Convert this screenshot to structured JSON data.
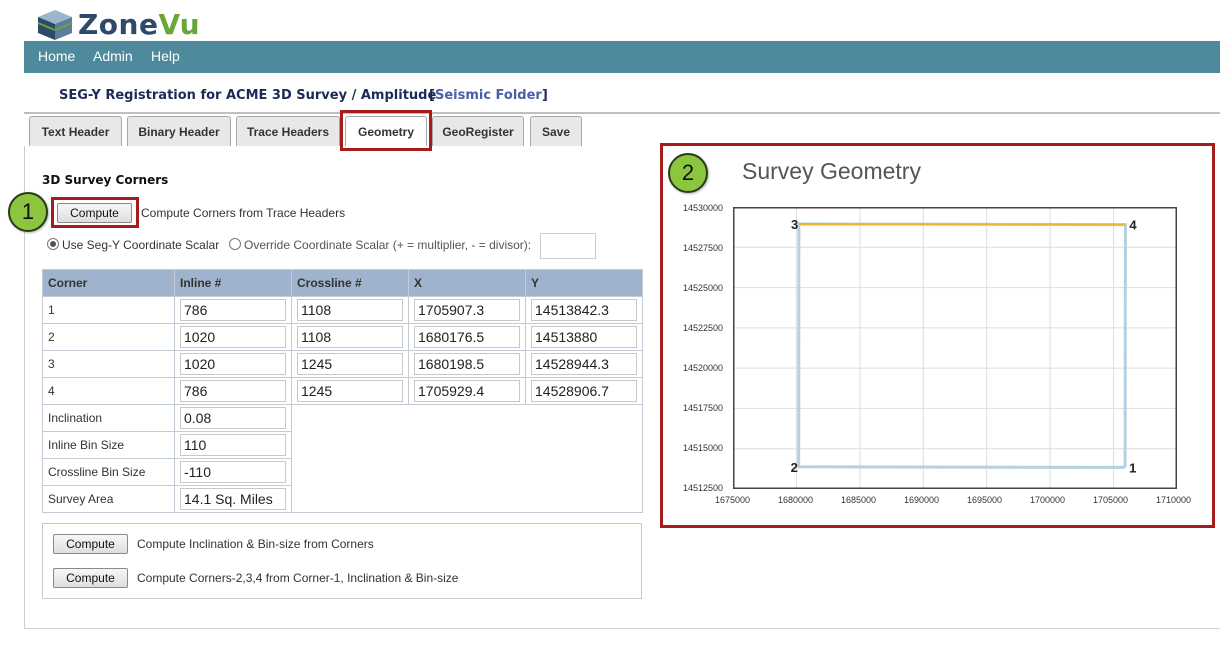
{
  "app": {
    "logo_part1": "Zone",
    "logo_part2": "Vu"
  },
  "nav": {
    "items": [
      "Home",
      "Admin",
      "Help"
    ]
  },
  "header": {
    "title": "SEG-Y Registration for ACME 3D Survey / Amplitude",
    "folder_open": "[",
    "folder_link": "Seismic Folder",
    "folder_close": "]"
  },
  "tabs": [
    {
      "label": "Text Header"
    },
    {
      "label": "Binary Header"
    },
    {
      "label": "Trace Headers"
    },
    {
      "label": "Geometry",
      "active": true
    },
    {
      "label": "GeoRegister"
    },
    {
      "label": "Save"
    }
  ],
  "callouts": [
    "1",
    "2"
  ],
  "corners_section": {
    "title": "3D Survey Corners",
    "compute_label": "Compute",
    "compute_desc": "Compute Corners from Trace Headers",
    "radio_use": "Use Seg-Y Coordinate Scalar",
    "radio_override": "Override Coordinate Scalar (+ = multiplier, - = divisor):",
    "scalar_value": ""
  },
  "table": {
    "headers": [
      "Corner",
      "Inline #",
      "Crossline #",
      "X",
      "Y"
    ],
    "rows": [
      {
        "corner": "1",
        "inline": "786",
        "crossline": "1108",
        "x": "1705907.3",
        "y": "14513842.3"
      },
      {
        "corner": "2",
        "inline": "1020",
        "crossline": "1108",
        "x": "1680176.5",
        "y": "14513880"
      },
      {
        "corner": "3",
        "inline": "1020",
        "crossline": "1245",
        "x": "1680198.5",
        "y": "14528944.3"
      },
      {
        "corner": "4",
        "inline": "786",
        "crossline": "1245",
        "x": "1705929.4",
        "y": "14528906.7"
      }
    ],
    "extras": [
      {
        "label": "Inclination",
        "value": "0.08"
      },
      {
        "label": "Inline Bin Size",
        "value": "110"
      },
      {
        "label": "Crossline Bin Size",
        "value": "-110"
      },
      {
        "label": "Survey Area",
        "value": "14.1 Sq. Miles"
      }
    ]
  },
  "compute_box": {
    "btn1": "Compute",
    "desc1": "Compute Inclination & Bin-size from Corners",
    "btn2": "Compute",
    "desc2": "Compute Corners-2,3,4 from Corner-1, Inclination & Bin-size"
  },
  "colors": {
    "nav": "#4e8a9c",
    "highlight": "#a61c1c",
    "table_header": "#9fb4cc",
    "outline": "#b5d0df",
    "top_edge": "#f0b530",
    "callout": "#8cc63f"
  },
  "chart_data": {
    "type": "line",
    "title": "Survey Geometry",
    "xlim": [
      1675000,
      1710000
    ],
    "ylim": [
      14512500,
      14530000
    ],
    "xticks": [
      "1675000",
      "1680000",
      "1685000",
      "1690000",
      "1695000",
      "1700000",
      "1705000",
      "1710000"
    ],
    "yticks": [
      "14530000",
      "14527500",
      "14525000",
      "14522500",
      "14520000",
      "14517500",
      "14515000",
      "14512500"
    ],
    "grid": true,
    "series": [
      {
        "color": "#b5d0df",
        "points": [
          [
            1705907.3,
            14513842.3
          ],
          [
            1680176.5,
            14513880
          ],
          [
            1680198.5,
            14528944.3
          ],
          [
            1705929.4,
            14528906.7
          ],
          [
            1705907.3,
            14513842.3
          ]
        ]
      },
      {
        "color": "#f0b530",
        "points": [
          [
            1680198.5,
            14528944.3
          ],
          [
            1705929.4,
            14528906.7
          ]
        ]
      }
    ],
    "corner_labels": [
      {
        "text": "1",
        "x": 1705907.3,
        "y": 14513842.3
      },
      {
        "text": "2",
        "x": 1680176.5,
        "y": 14513880
      },
      {
        "text": "3",
        "x": 1680198.5,
        "y": 14528944.3
      },
      {
        "text": "4",
        "x": 1705929.4,
        "y": 14528906.7
      }
    ]
  }
}
